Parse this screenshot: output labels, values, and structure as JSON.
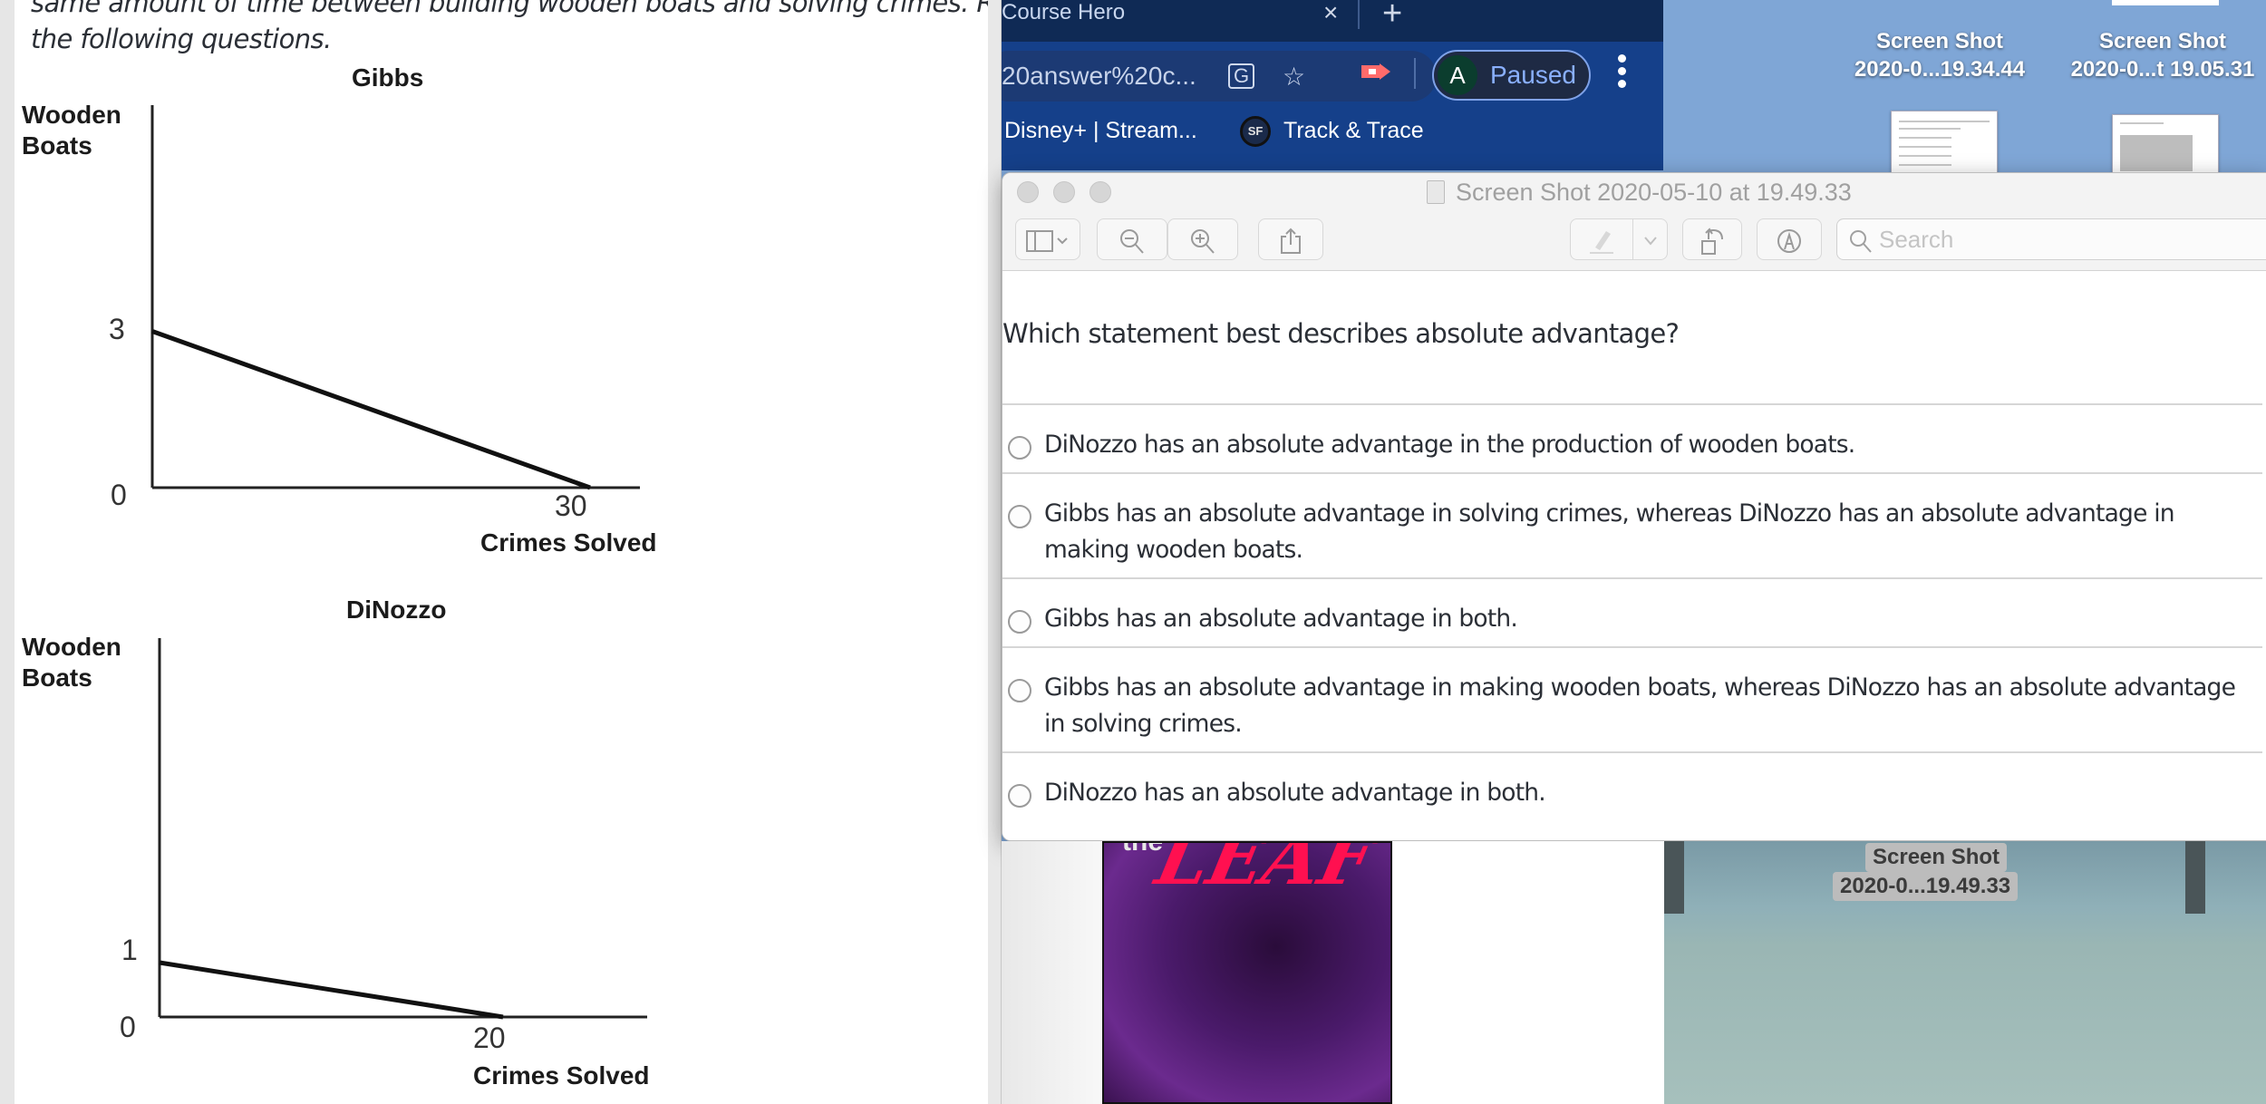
{
  "left_pane": {
    "intro_line_1": "same amount of time between building wooden boats and solving crimes. Refer to th",
    "intro_line_2": "the following questions."
  },
  "chart_data": [
    {
      "type": "line",
      "title": "Gibbs",
      "xlabel": "Crimes Solved",
      "ylabel_line1": "Wooden",
      "ylabel_line2": "Boats",
      "x": [
        0,
        30
      ],
      "y": [
        3,
        0
      ],
      "x_ticks": [
        "0",
        "30"
      ],
      "y_ticks": [
        "3"
      ],
      "origin_label": "0",
      "grid": false
    },
    {
      "type": "line",
      "title": "DiNozzo",
      "xlabel": "Crimes Solved",
      "ylabel_line1": "Wooden",
      "ylabel_line2": "Boats",
      "x": [
        0,
        20
      ],
      "y": [
        1,
        0
      ],
      "x_ticks": [
        "0",
        "20"
      ],
      "y_ticks": [
        "1"
      ],
      "origin_label": "0",
      "grid": false
    }
  ],
  "browser": {
    "tab_title": "Course Hero",
    "tab_close": "×",
    "new_tab": "+",
    "url_fragment": "20answer%20c...",
    "translate_icon": "G",
    "star_icon": "☆",
    "profile_initial": "A",
    "profile_status": "Paused",
    "menu_icon": "⋮",
    "bookmarks": [
      {
        "label": "Disney+ | Stream..."
      },
      {
        "label": "Track & Trace",
        "icon": "SF"
      }
    ]
  },
  "desktop": {
    "icons_top": [
      {
        "line1": "Screen Shot",
        "line2": "2020-0...19.34.44"
      },
      {
        "line1": "Screen Shot",
        "line2": "2020-0...t 19.05.31"
      }
    ],
    "icon_bottom": {
      "line1": "Screen Shot",
      "line2": "2020-0...19.49.33"
    },
    "poster_the": "the",
    "poster_title": "LEAF"
  },
  "preview": {
    "window_title": "Screen Shot 2020-05-10 at 19.49.33",
    "search_placeholder": "Search",
    "question": "Which statement best describes absolute advantage?",
    "options": [
      {
        "text": "DiNozzo has an absolute advantage in the production of wooden boats.",
        "selected": false
      },
      {
        "text": "Gibbs has an absolute advantage in solving crimes, whereas DiNozzo has an absolute advantage in making wooden boats.",
        "selected": false
      },
      {
        "text": "Gibbs has an absolute advantage in both.",
        "selected": false
      },
      {
        "text": "Gibbs has an absolute advantage in making wooden boats, whereas DiNozzo has an absolute advantage in solving crimes.",
        "selected": false
      },
      {
        "text": "DiNozzo has an absolute advantage in both.",
        "selected": false
      }
    ]
  }
}
